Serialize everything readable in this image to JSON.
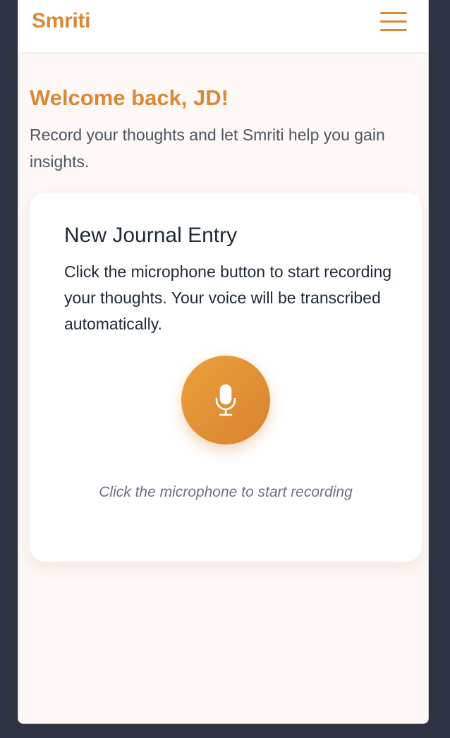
{
  "app": {
    "brand": "Smriti"
  },
  "header": {
    "menu_icon": "hamburger-menu-icon"
  },
  "welcome": {
    "title": "Welcome back, JD!",
    "subtitle": "Record your thoughts and let Smriti help you gain insights."
  },
  "journal_card": {
    "title": "New Journal Entry",
    "description": "Click the microphone button to start recording your thoughts. Your voice will be transcribed automatically.",
    "mic_icon": "microphone-icon",
    "hint": "Click the microphone to start recording"
  },
  "colors": {
    "accent": "#d98936",
    "background": "#fdf8f5",
    "frame": "#2e3243"
  }
}
